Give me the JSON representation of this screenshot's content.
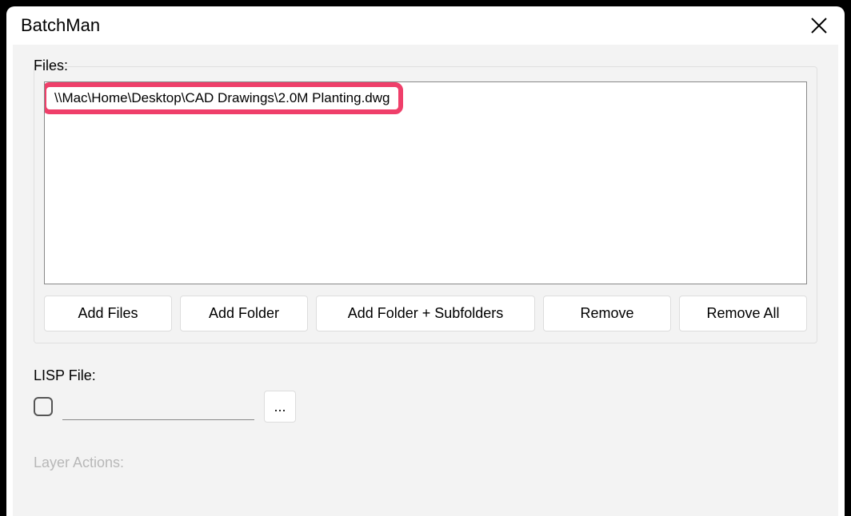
{
  "window": {
    "title": "BatchMan"
  },
  "files": {
    "label": "Files:",
    "items": [
      "\\\\Mac\\Home\\Desktop\\CAD Drawings\\2.0M Planting.dwg"
    ],
    "buttons": {
      "add_files": "Add Files",
      "add_folder": "Add Folder",
      "add_subfolders": "Add Folder + Subfolders",
      "remove": "Remove",
      "remove_all": "Remove All"
    }
  },
  "lisp": {
    "label": "LISP File:",
    "input_value": "",
    "browse_label": "..."
  },
  "layer_actions": {
    "label": "Layer Actions:"
  }
}
